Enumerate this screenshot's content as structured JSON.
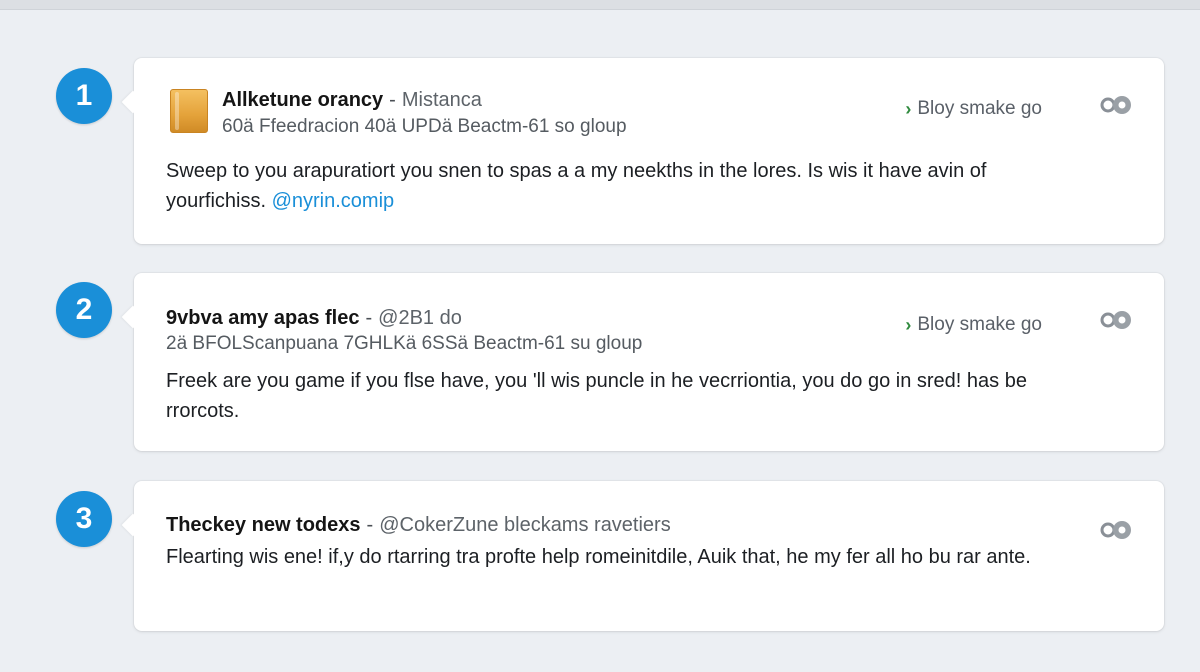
{
  "feed": {
    "items": [
      {
        "step": "1",
        "name": "Allketune orancy",
        "separator": "-",
        "handle": "Mistanca",
        "meta": "60ä Ffeedracion 40ä UPDä Beactm-61 so gloup",
        "action": "Bloy smake go",
        "action_icon": "arrow-right-icon",
        "body": "Sweep to you arapuratiort you snen to spas a a my neekths in the lores. Is wis it have avin of yourfichiss.",
        "link": "@nyrin.comip",
        "settings_icon": "gear-icon"
      },
      {
        "step": "2",
        "name": "9vbva amy apas flec",
        "separator": "-",
        "handle": "@2B1 do",
        "meta": "2ä BFOLScanpuana 7GHLKä 6SSä Beactm-61 su gloup",
        "action": "Bloy smake go",
        "action_icon": "arrow-right-icon",
        "body": "Freek are you game if you flse have, you 'll wis puncle in he vecrriontia, you do go in sred! has be rrorcots.",
        "settings_icon": "gear-icon"
      },
      {
        "step": "3",
        "name": "Theckey new todexs",
        "separator": "-",
        "handle": "@CokerZune bleckams ravetiers",
        "body": "Flearting wis ene! if,y do rtarring tra profte help romeinitdile, Auik that, he my fer all ho bu rar ante.",
        "settings_icon": "gear-icon"
      }
    ]
  },
  "colors": {
    "accent": "#1a8fd8",
    "background": "#eceff3",
    "card": "#ffffff",
    "action_arrow": "#2f8a3e"
  }
}
